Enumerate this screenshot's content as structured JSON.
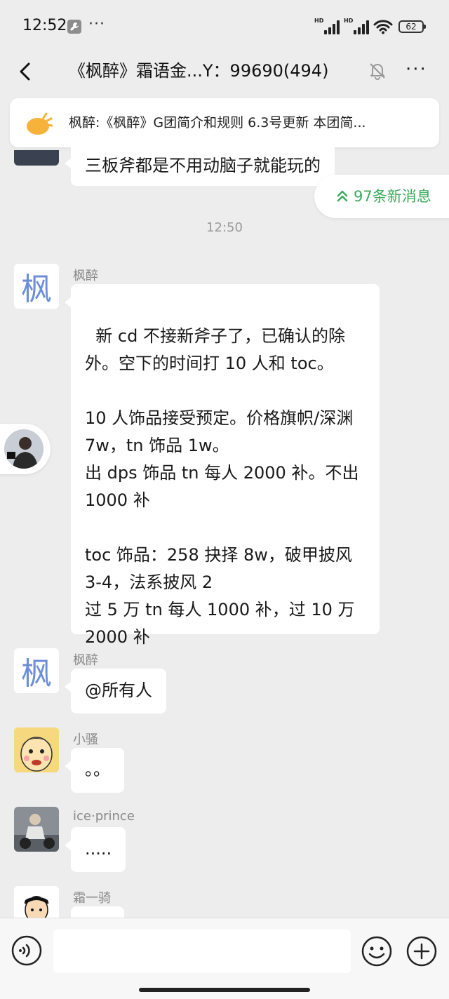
{
  "status": {
    "time": "12:52",
    "dots": "···",
    "sig1_label": "HD",
    "sig2_label": "HD",
    "battery": "62"
  },
  "header": {
    "title": "《枫醉》霜语金...Y：99690(494)"
  },
  "notice": {
    "text": "枫醉:《枫醉》G团简介和规则 6.3号更新  本团简..."
  },
  "new_messages": {
    "label": "97条新消息"
  },
  "timestamp": "12:50",
  "messages": [
    {
      "sender": "",
      "avatar": "dark-avatar",
      "text": "三板斧都是不用动脑子就能玩的"
    },
    {
      "sender": "枫醉",
      "avatar_text": "枫",
      "text": "新 cd 不接新斧子了，已确认的除外。空下的时间打 10 人和 toc。\n\n10 人饰品接受预定。价格旗帜/深渊 7w，tn 饰品 1w。\n出 dps 饰品 tn 每人 2000 补。不出 1000 补\n\ntoc 饰品：258 抉择 8w，破甲披风 3-4，法系披风 2\n过 5 万 tn 每人 1000 补，过 10 万 2000 补"
    },
    {
      "sender": "枫醉",
      "avatar_text": "枫",
      "text": "@所有人"
    },
    {
      "sender": "小骚",
      "avatar": "cartoon-face-avatar",
      "text": "。。"
    },
    {
      "sender": "ice·prince",
      "avatar": "rider-avatar",
      "text": "....."
    },
    {
      "sender": "霜一骑",
      "avatar": "boy-avatar",
      "text": ""
    }
  ],
  "input": {
    "placeholder": ""
  },
  "colors": {
    "background": "#ededed",
    "bubble": "#ffffff",
    "accent_green": "#3caa5d",
    "avatar_blue": "#6c8ed8"
  }
}
